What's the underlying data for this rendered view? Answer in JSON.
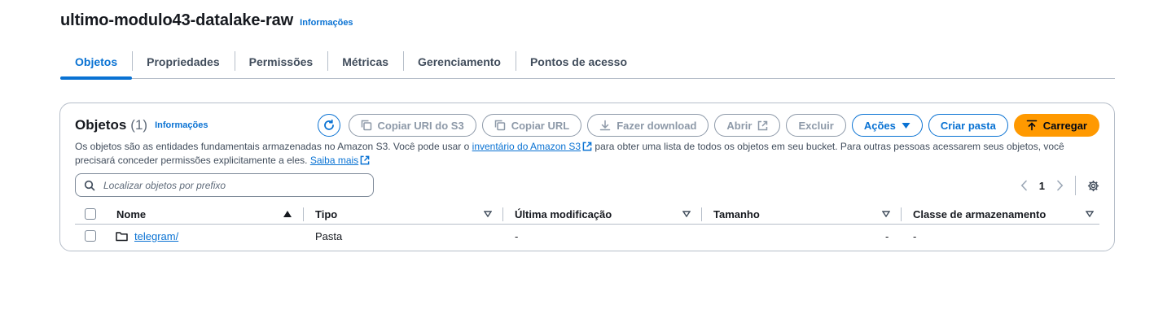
{
  "header": {
    "title": "ultimo-modulo43-datalake-raw",
    "info": "Informações"
  },
  "tabs": [
    {
      "label": "Objetos",
      "active": true
    },
    {
      "label": "Propriedades"
    },
    {
      "label": "Permissões"
    },
    {
      "label": "Métricas"
    },
    {
      "label": "Gerenciamento"
    },
    {
      "label": "Pontos de acesso"
    }
  ],
  "panel": {
    "title": "Objetos",
    "count": "(1)",
    "info": "Informações",
    "buttons": {
      "refresh": "refresh-icon",
      "copy_uri": "Copiar URI do S3",
      "copy_url": "Copiar URL",
      "download": "Fazer download",
      "open": "Abrir",
      "delete": "Excluir",
      "actions": "Ações",
      "create_folder": "Criar pasta",
      "upload": "Carregar"
    },
    "description": {
      "part1": "Os objetos são as entidades fundamentais armazenadas no Amazon S3. Você pode usar o ",
      "link1": "inventário do Amazon S3",
      "part2": " para obter uma lista de todos os objetos em seu bucket. Para outras pessoas acessarem seus objetos, você precisará conceder permissões explicitamente a eles. ",
      "link2": "Saiba mais"
    },
    "search": {
      "placeholder": "Localizar objetos por prefixo",
      "value": ""
    },
    "pagination": {
      "page": "1"
    },
    "accent": "#0972d3",
    "primary_color": "#ff9900"
  },
  "table": {
    "columns": [
      "Nome",
      "Tipo",
      "Última modificação",
      "Tamanho",
      "Classe de armazenamento"
    ],
    "rows": [
      {
        "name": "telegram/",
        "type": "Pasta",
        "modified": "-",
        "size": "-",
        "storage": "-"
      }
    ]
  }
}
